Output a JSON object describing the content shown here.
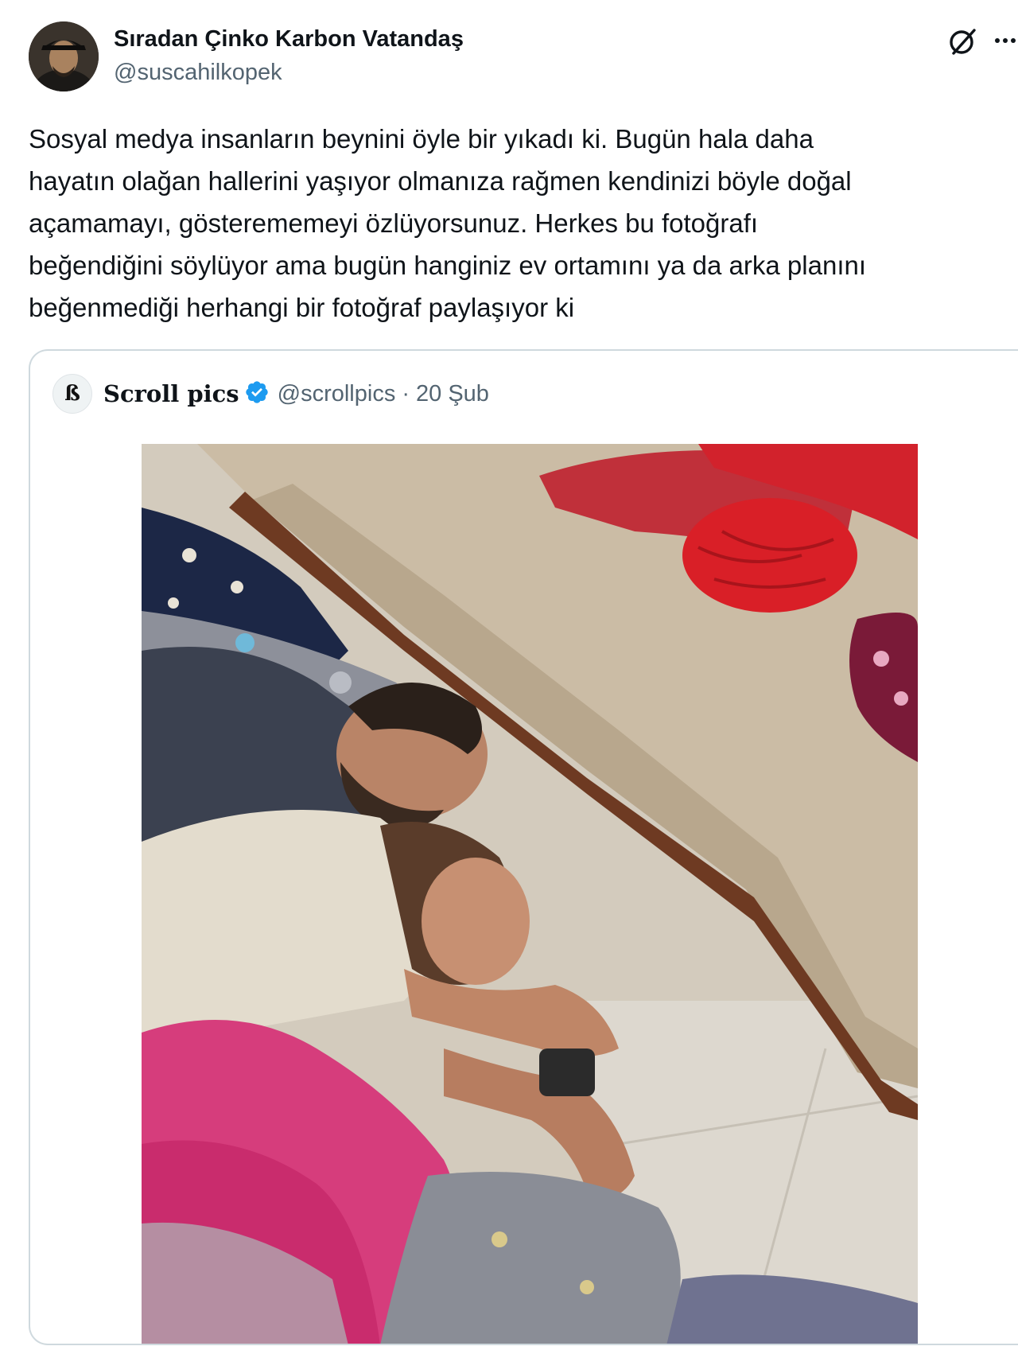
{
  "tweet": {
    "author": {
      "display_name": "Sıradan Çinko Karbon Vatandaş",
      "handle": "@suscahilkopek"
    },
    "text": "Sosyal medya insanların beynini öyle bir yıkadı ki. Bugün hala daha\nhayatın olağan hallerini yaşıyor olmanıza rağmen kendinizi böyle doğal\naçamamayı, gösterememeyi özlüyorsunuz. Herkes bu fotoğrafı\nbeğendiğini söylüyor ama bugün hanginiz ev ortamını ya da arka planını\nbeğenmediği herhangi bir fotoğraf paylaşıyor ki",
    "actions": {
      "grok_icon": "grok-icon",
      "more_icon": "more-icon",
      "more_label": "···"
    }
  },
  "quoted_tweet": {
    "avatar_letter": "ß",
    "display_name": "Scroll pics",
    "verified_icon": "verified-badge-icon",
    "handle": "@scrollpics",
    "separator": "·",
    "date": "20 Şub"
  },
  "colors": {
    "text_primary": "#0f1419",
    "text_secondary": "#536471",
    "border": "#cfd9de",
    "verified_blue": "#1d9bf0"
  }
}
